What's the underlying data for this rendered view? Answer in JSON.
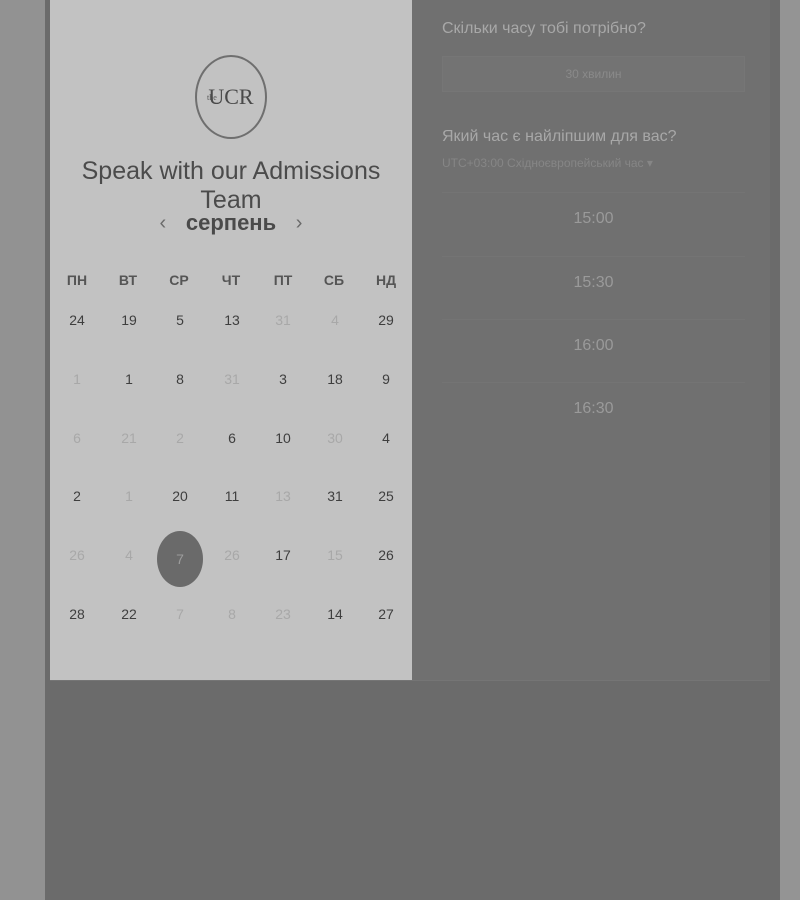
{
  "logo": {
    "text": "UCR",
    "prefix": "the"
  },
  "page_title": "Speak with our Admissions Team",
  "calendar": {
    "month": "серпень",
    "prev_arrow": "‹",
    "next_arrow": "›",
    "weekdays": [
      "ПН",
      "ВТ",
      "СР",
      "ЧТ",
      "ПТ",
      "СБ",
      "НД"
    ],
    "rows": [
      [
        {
          "d": "24"
        },
        {
          "d": "19"
        },
        {
          "d": "5"
        },
        {
          "d": "13"
        },
        {
          "d": "31",
          "dim": true
        },
        {
          "d": "4",
          "dim": true
        },
        {
          "d": "29"
        }
      ],
      [
        {
          "d": "1",
          "dim": true
        },
        {
          "d": "1"
        },
        {
          "d": "8"
        },
        {
          "d": "31",
          "dim": true
        },
        {
          "d": "3"
        },
        {
          "d": "18"
        },
        {
          "d": "9"
        }
      ],
      [
        {
          "d": "6",
          "dim": true
        },
        {
          "d": "21",
          "dim": true
        },
        {
          "d": "2",
          "dim": true
        },
        {
          "d": "6"
        },
        {
          "d": "10"
        },
        {
          "d": "30",
          "dim": true
        },
        {
          "d": "4"
        }
      ],
      [
        {
          "d": "2"
        },
        {
          "d": "1",
          "dim": true
        },
        {
          "d": "20"
        },
        {
          "d": "11"
        },
        {
          "d": "13",
          "dim": true
        },
        {
          "d": "31"
        },
        {
          "d": "25"
        }
      ],
      [
        {
          "d": "26",
          "dim": true
        },
        {
          "d": "4",
          "dim": true
        },
        {
          "d": "7",
          "selected": true
        },
        {
          "d": "26",
          "dim": true
        },
        {
          "d": "17"
        },
        {
          "d": "15",
          "dim": true
        },
        {
          "d": "26"
        }
      ],
      [
        {
          "d": "28"
        },
        {
          "d": "22"
        },
        {
          "d": "7",
          "dim": true
        },
        {
          "d": "8",
          "dim": true
        },
        {
          "d": "23",
          "dim": true
        },
        {
          "d": "14"
        },
        {
          "d": "27"
        }
      ]
    ]
  },
  "booking": {
    "duration_question": "Скільки часу тобі потрібно?",
    "duration_value": "30 хвилин",
    "time_question": "Який час є найліпшим для вас?",
    "timezone": "UTC+03:00 Східноєвропейський час ▾",
    "slots": [
      "15:00",
      "15:30",
      "16:00",
      "16:30"
    ]
  }
}
